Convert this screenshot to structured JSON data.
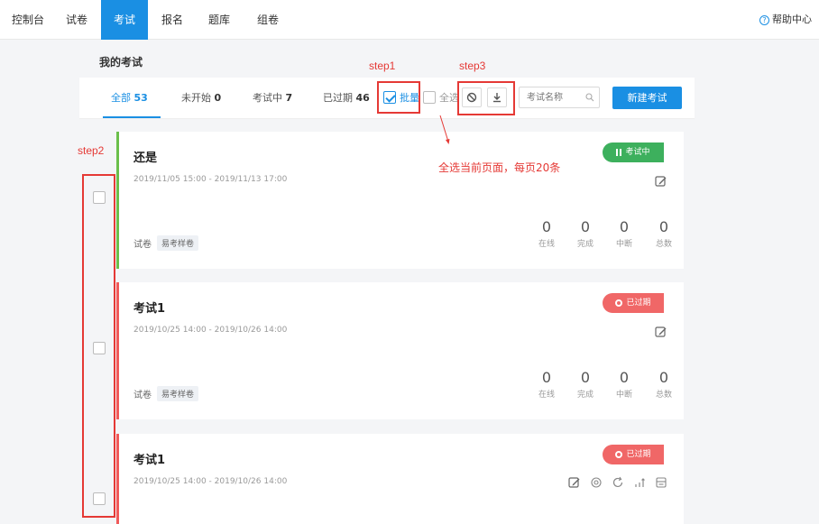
{
  "nav": {
    "items": [
      {
        "label": "控制台"
      },
      {
        "label": "试卷"
      },
      {
        "label": "考试"
      },
      {
        "label": "报名"
      },
      {
        "label": "题库"
      },
      {
        "label": "组卷"
      }
    ],
    "help": "帮助中心"
  },
  "page_title": "我的考试",
  "tabs": [
    {
      "label": "全部",
      "count": "53"
    },
    {
      "label": "未开始",
      "count": "0"
    },
    {
      "label": "考试中",
      "count": "7"
    },
    {
      "label": "已过期",
      "count": "46"
    }
  ],
  "toolbar": {
    "batch_label": "批量",
    "select_all_label": "全选",
    "search_placeholder": "考试名称",
    "new_button": "新建考试"
  },
  "annotations": {
    "step1": "step1",
    "step2": "step2",
    "step3": "step3",
    "note": "全选当前页面，每页20条"
  },
  "exams": [
    {
      "title": "还是",
      "time": "2019/11/05 15:00 - 2019/11/13 17:00",
      "status": "考试中",
      "status_color": "#3db05d",
      "paper_label": "试卷",
      "paper_tag": "易考样卷",
      "stats": [
        {
          "value": "0",
          "label": "在线"
        },
        {
          "value": "0",
          "label": "完成"
        },
        {
          "value": "0",
          "label": "中断"
        },
        {
          "value": "0",
          "label": "总数"
        }
      ]
    },
    {
      "title": "考试1",
      "time": "2019/10/25 14:00 - 2019/10/26 14:00",
      "status": "已过期",
      "status_color": "#f06767",
      "paper_label": "试卷",
      "paper_tag": "易考样卷",
      "stats": [
        {
          "value": "0",
          "label": "在线"
        },
        {
          "value": "0",
          "label": "完成"
        },
        {
          "value": "0",
          "label": "中断"
        },
        {
          "value": "0",
          "label": "总数"
        }
      ]
    },
    {
      "title": "考试1",
      "time": "2019/10/25 14:00 - 2019/10/26 14:00",
      "status": "已过期",
      "status_color": "#f06767"
    }
  ],
  "colors": {
    "accent": "#1a8fe3",
    "annotation": "#e53935"
  }
}
